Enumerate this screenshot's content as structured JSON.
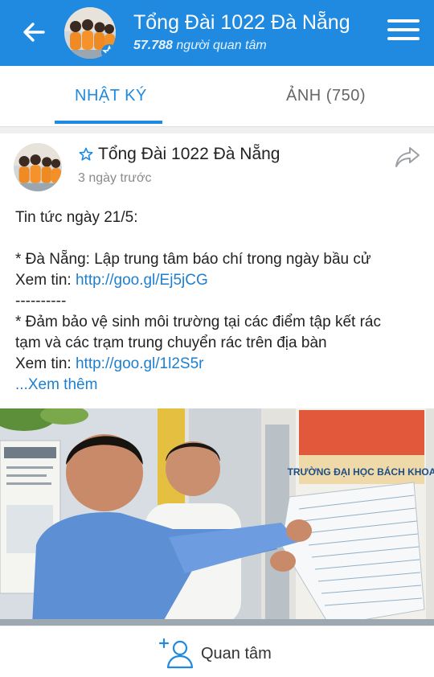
{
  "header": {
    "title": "Tổng Đài 1022 Đà Nẵng",
    "followers_count": "57.788",
    "followers_text": "người quan tâm",
    "back_icon": "back-arrow-icon",
    "menu_icon": "hamburger-menu-icon"
  },
  "tabs": [
    {
      "label": "NHẬT KÝ",
      "active": true
    },
    {
      "label": "ẢNH (750)",
      "active": false
    }
  ],
  "post": {
    "author": "Tổng Đài 1022 Đà Nẵng",
    "time": "3 ngày trước",
    "lines": [
      {
        "text": "Tin tức ngày 21/5:"
      },
      {
        "text": ""
      },
      {
        "text": "* Đà Nẵng: Lập trung tâm báo chí trong ngày bầu cử"
      },
      {
        "prefix": "Xem tin: ",
        "link": "http://goo.gl/Ej5jCG"
      },
      {
        "text": "----------"
      },
      {
        "text": "* Đảm bảo vệ sinh môi trường tại các điểm tập kết rác"
      },
      {
        "text": "tạm và các trạm trung chuyển rác trên địa bàn"
      },
      {
        "prefix": "Xem tin: ",
        "link": "http://goo.gl/1l2S5r"
      }
    ],
    "see_more": "...Xem thêm",
    "photo_sign": "TRƯỜNG ĐẠI HỌC BÁCH KHOA"
  },
  "footer": {
    "follow_label": "Quan tâm",
    "follow_icon": "add-follow-user-icon"
  },
  "colors": {
    "brand_blue": "#1f8ae0",
    "link_blue": "#1f7fcf"
  }
}
